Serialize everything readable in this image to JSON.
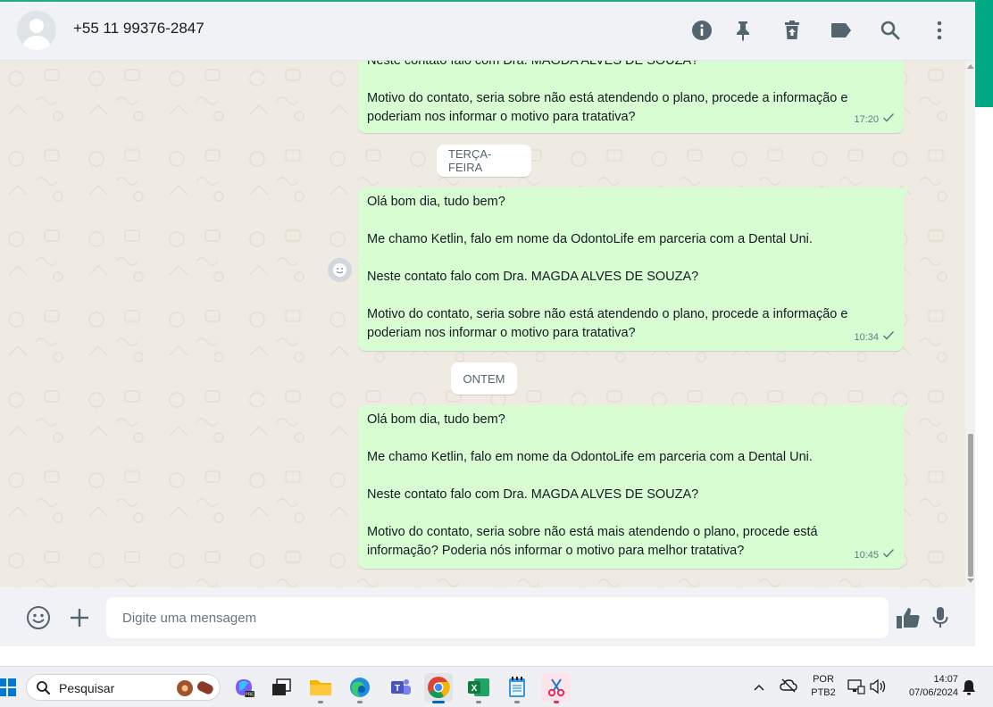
{
  "header": {
    "contact_name": "+55 11 99376-2847",
    "icons": [
      "info-icon",
      "pin-icon",
      "delete-icon",
      "label-icon",
      "search-icon",
      "more-vertical-icon"
    ]
  },
  "chat": {
    "bubble_top": {
      "lines": [
        "Neste contato falo com Dra. MAGDA ALVES DE SOUZA?",
        "",
        "Motivo do contato, seria sobre não está atendendo o plano, procede a informação e",
        "poderiam nos informar o motivo para tratativa?"
      ],
      "time": "17:20"
    },
    "day_1": "TERÇA-FEIRA",
    "bubble_mid": {
      "lines": [
        "Olá bom dia, tudo bem?",
        "",
        "Me chamo Ketlin, falo em nome da OdontoLife em parceria com a Dental Uni.",
        "",
        "Neste contato falo com Dra. MAGDA ALVES DE SOUZA?",
        "",
        "Motivo do contato, seria sobre não está atendendo o plano, procede a informação e",
        "poderiam nos informar o motivo para tratativa?"
      ],
      "time": "10:34"
    },
    "day_2": "ONTEM",
    "bubble_last": {
      "lines": [
        "Olá bom dia, tudo bem?",
        "",
        "Me chamo Ketlin, falo em nome da OdontoLife em parceria com a Dental Uni.",
        "",
        "Neste contato falo com Dra. MAGDA ALVES DE SOUZA?",
        "",
        "Motivo do contato, seria sobre não está mais atendendo o plano, procede está",
        "informação? Poderia nós informar o motivo para melhor tratativa?"
      ],
      "time": "10:45"
    }
  },
  "footer": {
    "placeholder": "Digite uma mensagem"
  },
  "taskbar": {
    "search_label": "Pesquisar",
    "lang_1": "POR",
    "lang_2": "PTB2",
    "time": "14:07",
    "date": "07/06/2024"
  },
  "colors": {
    "outgoing_bubble": "#d9fdd3",
    "chat_bg": "#efeae2",
    "accent": "#00a884"
  }
}
